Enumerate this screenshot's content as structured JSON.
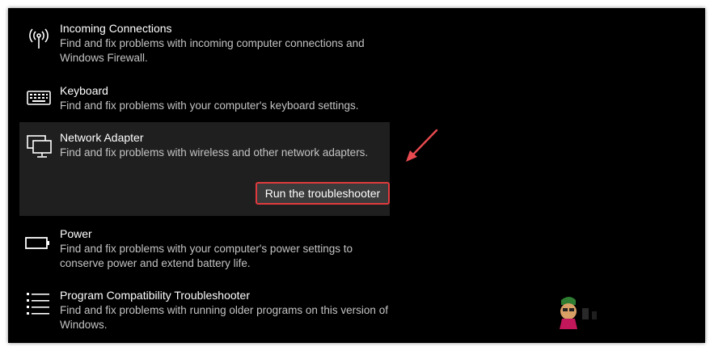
{
  "items": [
    {
      "title": "Incoming Connections",
      "description": "Find and fix problems with incoming computer connections and Windows Firewall.",
      "icon": "antenna-icon"
    },
    {
      "title": "Keyboard",
      "description": "Find and fix problems with your computer's keyboard settings.",
      "icon": "keyboard-icon"
    },
    {
      "title": "Network Adapter",
      "description": "Find and fix problems with wireless and other network adapters.",
      "icon": "network-adapter-icon",
      "action_label": "Run the troubleshooter"
    },
    {
      "title": "Power",
      "description": "Find and fix problems with your computer's power settings to conserve power and extend battery life.",
      "icon": "battery-icon"
    },
    {
      "title": "Program Compatibility Troubleshooter",
      "description": "Find and fix problems with running older programs on this version of Windows.",
      "icon": "list-icon"
    }
  ],
  "colors": {
    "background": "#000000",
    "expanded_background": "#1f1f1f",
    "highlight_border": "#e03a3e",
    "arrow": "#e84a4f"
  }
}
